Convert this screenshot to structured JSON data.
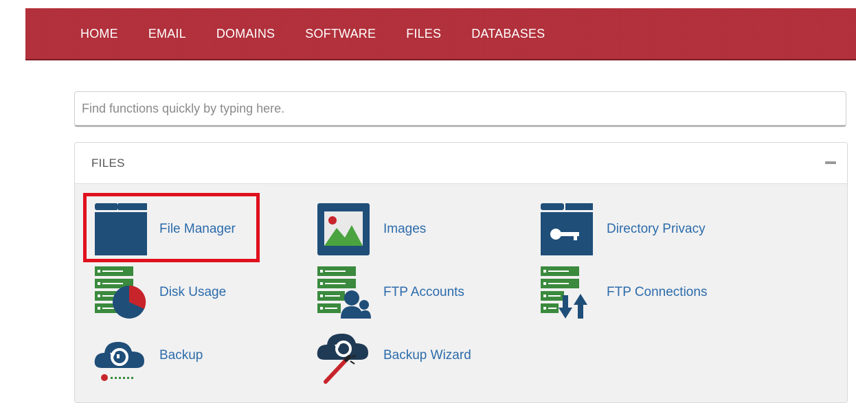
{
  "nav": {
    "items": [
      "HOME",
      "EMAIL",
      "DOMAINS",
      "SOFTWARE",
      "FILES",
      "DATABASES"
    ]
  },
  "search": {
    "placeholder": "Find functions quickly by typing here.",
    "value": ""
  },
  "panel": {
    "title": "FILES",
    "items": [
      {
        "label": "File Manager",
        "icon": "folder-icon"
      },
      {
        "label": "Images",
        "icon": "image-icon"
      },
      {
        "label": "Directory Privacy",
        "icon": "folder-key-icon"
      },
      {
        "label": "Disk Usage",
        "icon": "disk-usage-icon"
      },
      {
        "label": "FTP Accounts",
        "icon": "ftp-accounts-icon"
      },
      {
        "label": "FTP Connections",
        "icon": "ftp-connections-icon"
      },
      {
        "label": "Backup",
        "icon": "backup-icon"
      },
      {
        "label": "Backup Wizard",
        "icon": "backup-wizard-icon"
      }
    ]
  },
  "colors": {
    "nav_bg": "#b5323d",
    "link": "#2c6bab",
    "icon_navy": "#1f4e79",
    "icon_green": "#3b8a3e",
    "highlight": "#e0101d"
  }
}
